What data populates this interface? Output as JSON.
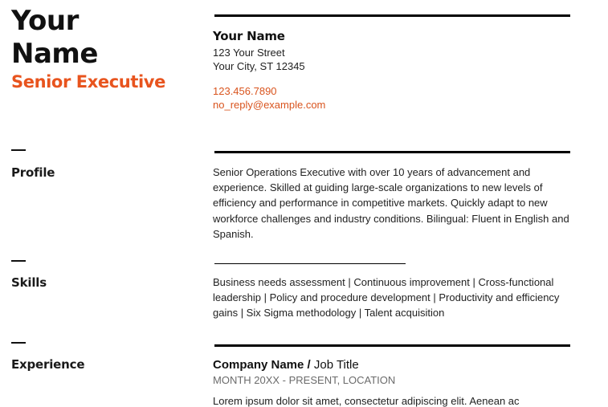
{
  "header": {
    "name_line1": "Your",
    "name_line2": "Name",
    "title": "Senior Executive"
  },
  "contact": {
    "name": "Your Name",
    "street": "123 Your Street",
    "city": "Your City, ST 12345",
    "phone": "123.456.7890",
    "email": "no_reply@example.com"
  },
  "sections": {
    "profile": {
      "label": "Profile",
      "text": "Senior Operations Executive with over 10 years of advancement and experience. Skilled at guiding large-scale organizations to new levels of efficiency and performance in competitive markets. Quickly adapt to new workforce challenges and industry conditions. Bilingual: Fluent in English and Spanish."
    },
    "skills": {
      "label": "Skills",
      "text": "Business needs assessment | Continuous improvement | Cross-functional leadership | Policy and procedure development | Productivity and efficiency gains | Six Sigma methodology | Talent acquisition"
    },
    "experience": {
      "label": "Experience",
      "company": "Company Name / ",
      "job_title": "Job Title",
      "dates_location": "MONTH 20XX - PRESENT,  LOCATION",
      "description": "Lorem ipsum dolor sit amet, consectetur adipiscing elit. Aenean ac"
    }
  },
  "colors": {
    "accent": "#d9541e",
    "text": "#222222",
    "muted": "#6b6b6b"
  }
}
